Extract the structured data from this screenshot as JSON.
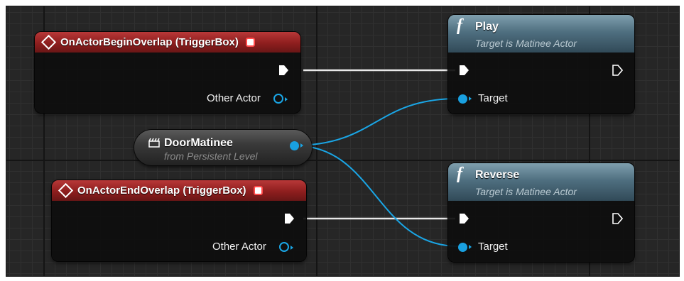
{
  "canvas": {
    "wire_exec_color": "#e8e8e8",
    "wire_object_color": "#1aa6e6"
  },
  "nodes": {
    "begin_overlap": {
      "title": "OnActorBeginOverlap (TriggerBox)",
      "pin_label": "Other Actor",
      "header_color": "#8e1e1e"
    },
    "end_overlap": {
      "title": "OnActorEndOverlap (TriggerBox)",
      "pin_label": "Other Actor",
      "header_color": "#8e1e1e"
    },
    "variable": {
      "name": "DoorMatinee",
      "subtitle": "from Persistent Level",
      "icon": "matinee-clapper-icon"
    },
    "play": {
      "title": "Play",
      "subtitle": "Target is Matinee Actor",
      "pin_label": "Target",
      "icon": "function-icon",
      "header_color": "#4f6f80"
    },
    "reverse": {
      "title": "Reverse",
      "subtitle": "Target is Matinee Actor",
      "pin_label": "Target",
      "icon": "function-icon",
      "header_color": "#4f6f80"
    }
  }
}
